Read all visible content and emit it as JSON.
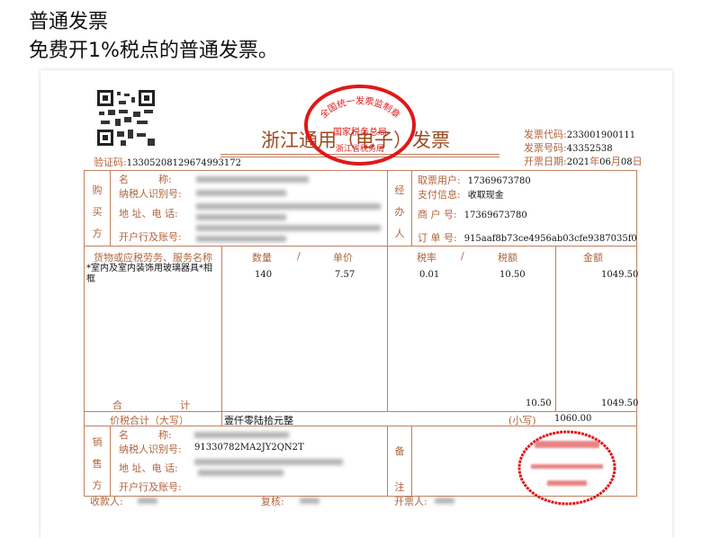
{
  "heading": {
    "title": "普通发票",
    "subtitle": "免费开1%税点的普通发票。"
  },
  "invoice": {
    "title": "浙江通用（电子）发票",
    "stamp_top": "全国统一发票监制章",
    "stamp_mid": "国家税务总局",
    "stamp_bottom": "浙江省税务局",
    "verify_label": "验证码:",
    "verify_code": "13305208129674993172",
    "code_label": "发票代码:",
    "code": "233001900111",
    "number_label": "发票号码:",
    "number": "43352538",
    "date_label": "开票日期:",
    "date_year": "2021",
    "date_month": "06",
    "date_day": "08",
    "y": "年",
    "m": "月",
    "d": "日",
    "buyer": {
      "side": [
        "购",
        "买",
        "方"
      ],
      "name": "名　　　称:",
      "tax_id": "纳税人识别号:",
      "addr": "地 址、电 话:",
      "bank": "开户行及账号:"
    },
    "agent": {
      "side": [
        "经",
        "办",
        "人"
      ],
      "user_label": "取票用户:",
      "user": "17369673780",
      "pay_label": "支付信息:",
      "pay": "收取现金",
      "merchant_label": "商 户 号:",
      "merchant": "17369673780",
      "order_label": "订 单 号:",
      "order": "915aaf8b73ce4956ab03cfe9387035f0"
    },
    "cols": {
      "item": "货物或应税劳务、服务名称",
      "qty": "数量",
      "slash": "/",
      "price": "单价",
      "rate": "税率",
      "tax": "税额",
      "amount": "金额"
    },
    "item": {
      "name": "*室内及室内装饰用玻璃器具*相框",
      "qty": "140",
      "price": "7.57",
      "rate": "0.01",
      "tax": "10.50",
      "amount": "1049.50"
    },
    "total": {
      "label_a": "合",
      "label_b": "计",
      "tax": "10.50",
      "amount": "1049.50"
    },
    "grand": {
      "label": "价税合计（大写）",
      "words": "壹仟零陆拾元整",
      "small_label": "(小写)",
      "value": "1060.00"
    },
    "seller": {
      "side": [
        "销",
        "售",
        "方"
      ],
      "name": "名　　　称:",
      "tax_id": "纳税人识别号:",
      "tax_id_value": "91330782MA2JY2QN2T",
      "addr": "地 址、电 话:",
      "bank": "开户行及账号:"
    },
    "remark": [
      "备",
      "注"
    ],
    "footer": {
      "payee": "收款人:",
      "review": "复核:",
      "issuer": "开票人:"
    }
  },
  "colors": {
    "label": "#b0643c",
    "border": "#c08060",
    "stamp": "#e01818"
  }
}
